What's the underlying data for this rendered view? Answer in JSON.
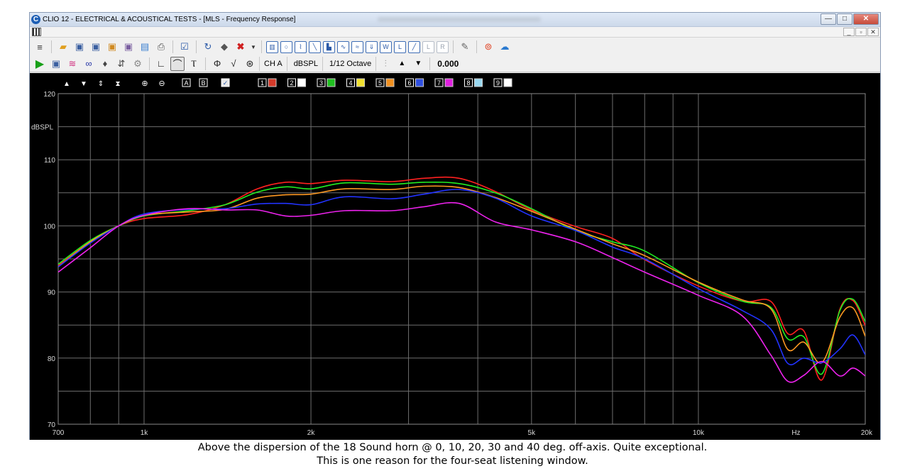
{
  "window": {
    "title": "CLIO 12 - ELECTRICAL & ACOUSTICAL TESTS - [MLS - Frequency Response]",
    "app_icon_letter": "C",
    "min_glyph": "—",
    "max_glyph": "□",
    "close_glyph": "✕"
  },
  "mdi": {
    "min": "_",
    "restore": "▫",
    "close": "✕"
  },
  "toolbar2": {
    "channel": "CH A",
    "unit": "dBSPL",
    "smoothing": "1/12 Octave",
    "value": "0.000"
  },
  "plot_toolbar": {
    "markers": [
      "A",
      "B"
    ],
    "overlays": [
      "1",
      "2",
      "3",
      "4",
      "5",
      "6",
      "7",
      "8",
      "9"
    ]
  },
  "colors": {
    "accent": "#1d5fb5",
    "grid": "#6e6e6e",
    "axis_text": "#d8d8d8",
    "plot_bg": "#000000"
  },
  "chart_data": {
    "type": "line",
    "ylabel": "dBSPL",
    "xunit_label": "Hz",
    "xscale": "log",
    "xlim": [
      700,
      20000
    ],
    "ylim": [
      70,
      120
    ],
    "yticks": [
      70,
      80,
      90,
      100,
      110,
      120
    ],
    "yticklabels": [
      "70",
      "80",
      "90",
      "100",
      "110",
      "120"
    ],
    "xticks": [
      700,
      1000,
      2000,
      5000,
      10000,
      20000
    ],
    "xticklabels": [
      "700",
      "1k",
      "2k",
      "5k",
      "10k",
      "20k"
    ],
    "grid": true,
    "series": [
      {
        "color": "#ff2020",
        "width": 1.6,
        "points": [
          [
            700,
            94
          ],
          [
            800,
            97.6
          ],
          [
            900,
            100
          ],
          [
            1000,
            101.1
          ],
          [
            1200,
            101.7
          ],
          [
            1400,
            103.2
          ],
          [
            1600,
            105.6
          ],
          [
            1800,
            106.6
          ],
          [
            2000,
            106.4
          ],
          [
            2300,
            106.9
          ],
          [
            2800,
            106.7
          ],
          [
            3200,
            107.2
          ],
          [
            3700,
            107.2
          ],
          [
            4300,
            105.2
          ],
          [
            5000,
            102.4
          ],
          [
            6000,
            99.9
          ],
          [
            7000,
            98.1
          ],
          [
            8000,
            94.9
          ],
          [
            10000,
            90.9
          ],
          [
            12000,
            88.6
          ],
          [
            13500,
            88.6
          ],
          [
            14500,
            83.7
          ],
          [
            15500,
            84.1
          ],
          [
            16700,
            76.7
          ],
          [
            18000,
            87.4
          ],
          [
            19000,
            88.7
          ],
          [
            20000,
            84.9
          ]
        ]
      },
      {
        "color": "#22ee22",
        "width": 1.6,
        "points": [
          [
            700,
            94.2
          ],
          [
            800,
            97.8
          ],
          [
            900,
            100
          ],
          [
            1000,
            101.5
          ],
          [
            1200,
            102.3
          ],
          [
            1400,
            103.2
          ],
          [
            1600,
            105.1
          ],
          [
            1800,
            105.9
          ],
          [
            2000,
            105.6
          ],
          [
            2300,
            106.5
          ],
          [
            2800,
            106.3
          ],
          [
            3200,
            106.6
          ],
          [
            3700,
            106.4
          ],
          [
            4300,
            105
          ],
          [
            5000,
            102.6
          ],
          [
            6000,
            99.3
          ],
          [
            7000,
            97.6
          ],
          [
            8000,
            96.2
          ],
          [
            10000,
            91.4
          ],
          [
            12000,
            88.6
          ],
          [
            13500,
            87.7
          ],
          [
            14500,
            82.9
          ],
          [
            15500,
            83.2
          ],
          [
            16700,
            77.6
          ],
          [
            18000,
            87.2
          ],
          [
            19000,
            88.9
          ],
          [
            20000,
            85.5
          ]
        ]
      },
      {
        "color": "#ff9922",
        "width": 1.6,
        "points": [
          [
            700,
            93.8
          ],
          [
            800,
            97.6
          ],
          [
            900,
            100
          ],
          [
            1000,
            101.6
          ],
          [
            1200,
            102.1
          ],
          [
            1400,
            102.5
          ],
          [
            1600,
            104.2
          ],
          [
            1800,
            104.7
          ],
          [
            2000,
            104.8
          ],
          [
            2300,
            105.6
          ],
          [
            2800,
            105.5
          ],
          [
            3200,
            106
          ],
          [
            3700,
            105.8
          ],
          [
            4300,
            104.3
          ],
          [
            5000,
            102.2
          ],
          [
            6000,
            99.5
          ],
          [
            7000,
            97.3
          ],
          [
            8000,
            95.5
          ],
          [
            10000,
            91.5
          ],
          [
            12000,
            88.8
          ],
          [
            13500,
            87.5
          ],
          [
            14500,
            81.3
          ],
          [
            15500,
            82.4
          ],
          [
            16700,
            79.3
          ],
          [
            18000,
            86.2
          ],
          [
            19000,
            87.6
          ],
          [
            20000,
            83.3
          ]
        ]
      },
      {
        "color": "#2233ff",
        "width": 1.6,
        "points": [
          [
            700,
            93.8
          ],
          [
            800,
            97.4
          ],
          [
            900,
            100
          ],
          [
            1000,
            101.8
          ],
          [
            1200,
            102.5
          ],
          [
            1400,
            102.6
          ],
          [
            1600,
            103.3
          ],
          [
            1800,
            103.4
          ],
          [
            2000,
            103.2
          ],
          [
            2300,
            104.4
          ],
          [
            2800,
            104.1
          ],
          [
            3200,
            104.8
          ],
          [
            3700,
            105.5
          ],
          [
            4300,
            104.2
          ],
          [
            5000,
            101.5
          ],
          [
            6000,
            99.3
          ],
          [
            7000,
            96.8
          ],
          [
            8000,
            95
          ],
          [
            10000,
            90.5
          ],
          [
            12000,
            87.2
          ],
          [
            13500,
            84.4
          ],
          [
            14500,
            79.2
          ],
          [
            15500,
            80
          ],
          [
            16700,
            79.3
          ],
          [
            18000,
            81.4
          ],
          [
            19000,
            83.5
          ],
          [
            20000,
            80.5
          ]
        ]
      },
      {
        "color": "#ee22ee",
        "width": 1.6,
        "points": [
          [
            700,
            93
          ],
          [
            800,
            96.7
          ],
          [
            900,
            100
          ],
          [
            1000,
            101.6
          ],
          [
            1200,
            102.6
          ],
          [
            1400,
            102.4
          ],
          [
            1600,
            102.4
          ],
          [
            1800,
            101.5
          ],
          [
            2000,
            101.6
          ],
          [
            2300,
            102.3
          ],
          [
            2800,
            102.3
          ],
          [
            3200,
            102.9
          ],
          [
            3700,
            103.4
          ],
          [
            4300,
            100.6
          ],
          [
            5000,
            99.4
          ],
          [
            6000,
            97.6
          ],
          [
            7000,
            95.2
          ],
          [
            8000,
            93
          ],
          [
            10000,
            89.5
          ],
          [
            12000,
            86.4
          ],
          [
            13500,
            80.5
          ],
          [
            14500,
            76.5
          ],
          [
            15500,
            77.4
          ],
          [
            16700,
            79.5
          ],
          [
            18000,
            77.3
          ],
          [
            19000,
            78.5
          ],
          [
            20000,
            77.3
          ]
        ]
      }
    ]
  },
  "caption": {
    "line1": "Above the dispersion of the 18 Sound horn @ 0, 10, 20, 30 and 40 deg. off-axis. Quite exceptional.",
    "line2": "This is one reason for the four-seat listening window."
  }
}
